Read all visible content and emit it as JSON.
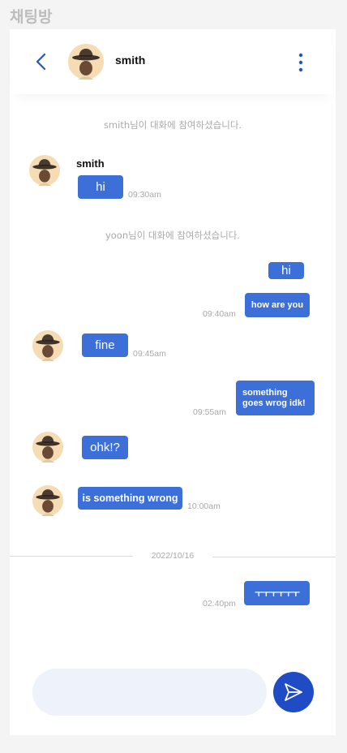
{
  "page": {
    "label": "채팅방"
  },
  "header": {
    "name": "smith",
    "back_icon": "chevron-left-icon",
    "more_icon": "vertical-dots-icon"
  },
  "colors": {
    "bubble": "#3c6fd8",
    "accent": "#1f4cc4",
    "input_bg": "#edf2fb"
  },
  "messages": {
    "sys1": "smith님이 대화에 참여하셨습니다.",
    "m1_sender": "smith",
    "m1_text": "hi",
    "m1_time": "09:30am",
    "sys2": "yoon님이 대화에 참여하셨습니다.",
    "m2_text": "hi",
    "m3_text": "how are  you",
    "m3_time": "09:40am",
    "m4_text": "fine",
    "m4_time": "09:45am",
    "m5_text": "something goes wrog idk!",
    "m5_time": "09:55am",
    "m6_text": "ohk!?",
    "m7_text": "is something wrong",
    "m7_time": "10:00am",
    "date": "2022/10/16",
    "m8_text": "ㅜㅜㅜㅜㅜㅜ",
    "m8_time": "02:40pm"
  },
  "composer": {
    "placeholder": "",
    "send_icon": "send-icon"
  }
}
